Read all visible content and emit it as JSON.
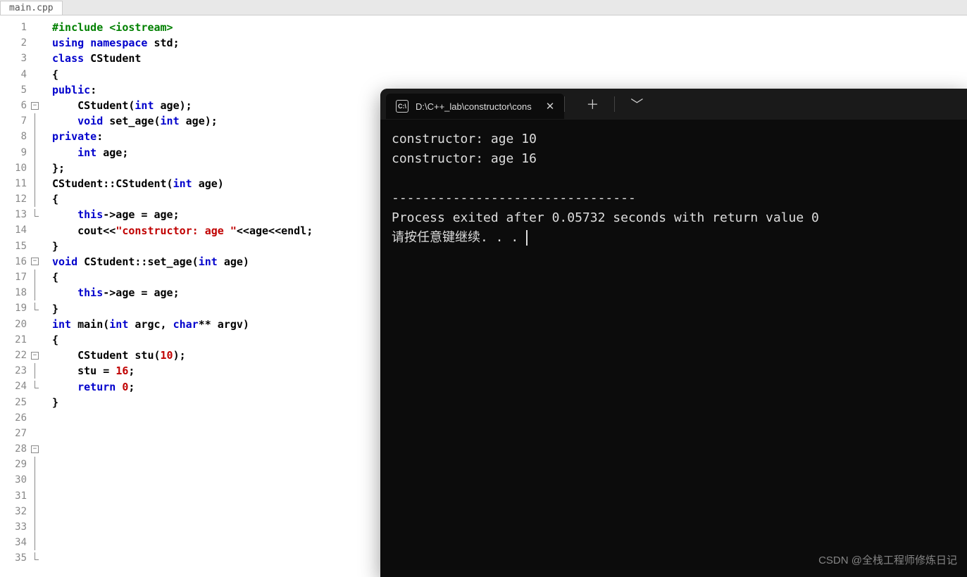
{
  "tab": {
    "filename": "main.cpp"
  },
  "code": {
    "lines": [
      {
        "n": 1,
        "fold": "",
        "segs": [
          [
            "pp",
            "#include <iostream>"
          ]
        ]
      },
      {
        "n": 2,
        "fold": "",
        "segs": [
          [
            "",
            ""
          ]
        ]
      },
      {
        "n": 3,
        "fold": "",
        "segs": [
          [
            "kw",
            "using"
          ],
          [
            "plain",
            " "
          ],
          [
            "kw",
            "namespace"
          ],
          [
            "plain",
            " std;"
          ]
        ]
      },
      {
        "n": 4,
        "fold": "",
        "segs": [
          [
            "",
            ""
          ]
        ]
      },
      {
        "n": 5,
        "fold": "",
        "segs": [
          [
            "kw",
            "class"
          ],
          [
            "plain",
            " CStudent"
          ]
        ]
      },
      {
        "n": 6,
        "fold": "open",
        "segs": [
          [
            "plain",
            "{"
          ]
        ]
      },
      {
        "n": 7,
        "fold": "line",
        "segs": [
          [
            "kw",
            "public"
          ],
          [
            "plain",
            ":"
          ]
        ]
      },
      {
        "n": 8,
        "fold": "line",
        "segs": [
          [
            "plain",
            "    CStudent("
          ],
          [
            "kw",
            "int"
          ],
          [
            "plain",
            " age);"
          ]
        ]
      },
      {
        "n": 9,
        "fold": "line",
        "segs": [
          [
            "",
            ""
          ]
        ]
      },
      {
        "n": 10,
        "fold": "line",
        "segs": [
          [
            "plain",
            "    "
          ],
          [
            "kw",
            "void"
          ],
          [
            "plain",
            " set_age("
          ],
          [
            "kw",
            "int"
          ],
          [
            "plain",
            " age);"
          ]
        ]
      },
      {
        "n": 11,
        "fold": "line",
        "segs": [
          [
            "kw",
            "private"
          ],
          [
            "plain",
            ":"
          ]
        ]
      },
      {
        "n": 12,
        "fold": "line",
        "segs": [
          [
            "plain",
            "    "
          ],
          [
            "kw",
            "int"
          ],
          [
            "plain",
            " age;"
          ]
        ]
      },
      {
        "n": 13,
        "fold": "end",
        "segs": [
          [
            "plain",
            "};"
          ]
        ]
      },
      {
        "n": 14,
        "fold": "",
        "segs": [
          [
            "",
            ""
          ]
        ]
      },
      {
        "n": 15,
        "fold": "",
        "segs": [
          [
            "plain",
            "CStudent::CStudent("
          ],
          [
            "kw",
            "int"
          ],
          [
            "plain",
            " age)"
          ]
        ]
      },
      {
        "n": 16,
        "fold": "open",
        "segs": [
          [
            "plain",
            "{"
          ]
        ]
      },
      {
        "n": 17,
        "fold": "line",
        "segs": [
          [
            "plain",
            "    "
          ],
          [
            "kw",
            "this"
          ],
          [
            "plain",
            "->age = age;"
          ]
        ]
      },
      {
        "n": 18,
        "fold": "line",
        "segs": [
          [
            "plain",
            "    cout<<"
          ],
          [
            "str",
            "\"constructor: age \""
          ],
          [
            "plain",
            "<<age<<endl;"
          ]
        ]
      },
      {
        "n": 19,
        "fold": "end",
        "segs": [
          [
            "plain",
            "}"
          ]
        ]
      },
      {
        "n": 20,
        "fold": "",
        "segs": [
          [
            "",
            ""
          ]
        ]
      },
      {
        "n": 21,
        "fold": "",
        "segs": [
          [
            "kw",
            "void"
          ],
          [
            "plain",
            " CStudent::set_age("
          ],
          [
            "kw",
            "int"
          ],
          [
            "plain",
            " age)"
          ]
        ]
      },
      {
        "n": 22,
        "fold": "open",
        "segs": [
          [
            "plain",
            "{"
          ]
        ]
      },
      {
        "n": 23,
        "fold": "line",
        "segs": [
          [
            "plain",
            "    "
          ],
          [
            "kw",
            "this"
          ],
          [
            "plain",
            "->age = age;"
          ]
        ]
      },
      {
        "n": 24,
        "fold": "end",
        "segs": [
          [
            "plain",
            "}"
          ]
        ]
      },
      {
        "n": 25,
        "fold": "",
        "segs": [
          [
            "",
            ""
          ]
        ]
      },
      {
        "n": 26,
        "fold": "",
        "segs": [
          [
            "",
            ""
          ]
        ]
      },
      {
        "n": 27,
        "fold": "",
        "segs": [
          [
            "kw",
            "int"
          ],
          [
            "plain",
            " main("
          ],
          [
            "kw",
            "int"
          ],
          [
            "plain",
            " argc, "
          ],
          [
            "kw",
            "char"
          ],
          [
            "plain",
            "** argv)"
          ]
        ]
      },
      {
        "n": 28,
        "fold": "open",
        "segs": [
          [
            "plain",
            "{"
          ]
        ]
      },
      {
        "n": 29,
        "fold": "line",
        "segs": [
          [
            "",
            ""
          ]
        ]
      },
      {
        "n": 30,
        "fold": "line",
        "segs": [
          [
            "plain",
            "    CStudent stu("
          ],
          [
            "num",
            "10"
          ],
          [
            "plain",
            ");"
          ]
        ]
      },
      {
        "n": 31,
        "fold": "line",
        "segs": [
          [
            "",
            ""
          ]
        ]
      },
      {
        "n": 32,
        "fold": "line",
        "segs": [
          [
            "plain",
            "    stu = "
          ],
          [
            "num",
            "16"
          ],
          [
            "plain",
            ";"
          ]
        ]
      },
      {
        "n": 33,
        "fold": "line",
        "segs": [
          [
            "",
            ""
          ]
        ]
      },
      {
        "n": 34,
        "fold": "line",
        "segs": [
          [
            "plain",
            "    "
          ],
          [
            "kw",
            "return"
          ],
          [
            "plain",
            " "
          ],
          [
            "num",
            "0"
          ],
          [
            "plain",
            ";"
          ]
        ]
      },
      {
        "n": 35,
        "fold": "end",
        "segs": [
          [
            "plain",
            "}"
          ]
        ]
      }
    ]
  },
  "terminal": {
    "tab_icon_text": "C:\\",
    "tab_title": "D:\\C++_lab\\constructor\\cons",
    "output": "constructor: age 10\nconstructor: age 16\n\n--------------------------------\nProcess exited after 0.05732 seconds with return value 0\n请按任意键继续. . . "
  },
  "watermark": "CSDN @全栈工程师修炼日记"
}
